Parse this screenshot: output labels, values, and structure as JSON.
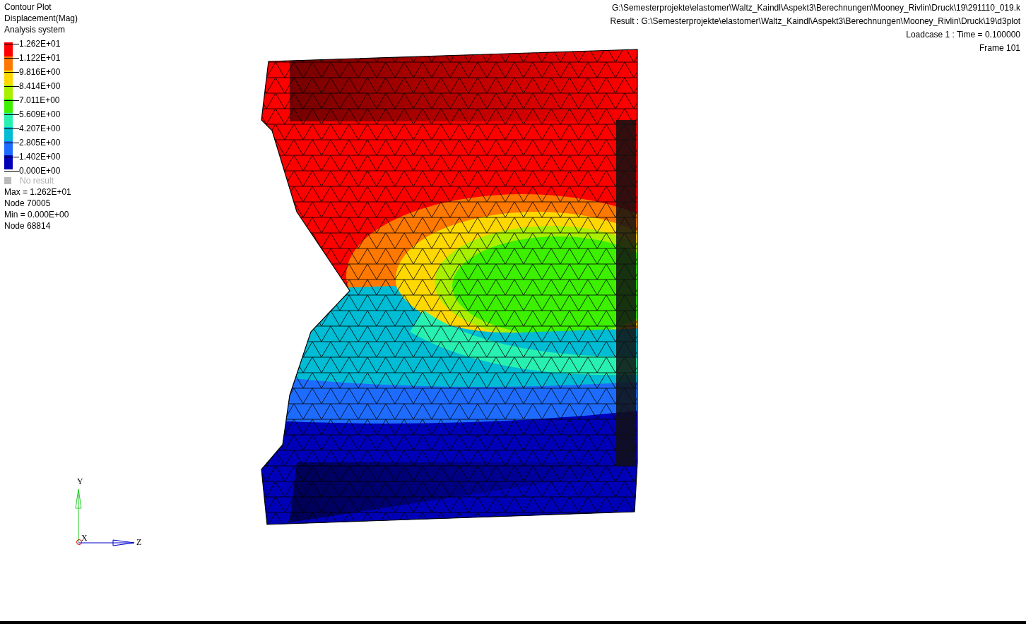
{
  "header": {
    "lines": [
      "Contour Plot",
      "Displacement(Mag)",
      "Analysis system"
    ]
  },
  "legend": {
    "ticks": [
      "1.262E+01",
      "1.122E+01",
      "9.816E+00",
      "8.414E+00",
      "7.011E+00",
      "5.609E+00",
      "4.207E+00",
      "2.805E+00",
      "1.402E+00",
      "0.000E+00"
    ],
    "bands": [
      {
        "color": "#ff0000"
      },
      {
        "color": "#ff7800"
      },
      {
        "color": "#ffd800"
      },
      {
        "color": "#a8f000"
      },
      {
        "color": "#3cf000"
      },
      {
        "color": "#28f0b0"
      },
      {
        "color": "#00bcd4"
      },
      {
        "color": "#1e6cff"
      },
      {
        "color": "#0000b8"
      }
    ],
    "no_result": "No result"
  },
  "stats": [
    "Max = 1.262E+01",
    "Node 70005",
    "Min = 0.000E+00",
    "Node 68814"
  ],
  "info": [
    "G:\\Semesterprojekte\\elastomer\\Waltz_Kaindl\\Aspekt3\\Berechnungen\\Mooney_Rivlin\\Druck\\19\\291110_019.k",
    "Result : G:\\Semesterprojekte\\elastomer\\Waltz_Kaindl\\Aspekt3\\Berechnungen\\Mooney_Rivlin\\Druck\\19\\d3plot",
    "Loadcase 1 : Time = 0.100000",
    "Frame 101"
  ],
  "triad": {
    "y": "Y",
    "x": "X",
    "z": "Z"
  }
}
